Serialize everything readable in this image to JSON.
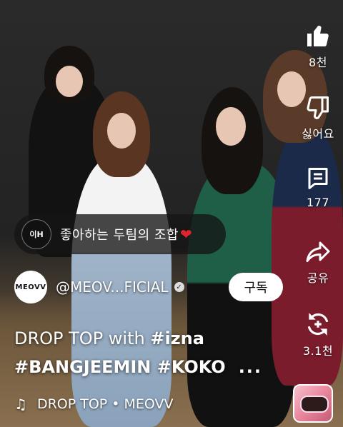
{
  "rail": {
    "like": {
      "icon": "thumbs-up-icon",
      "count": "8천"
    },
    "dislike": {
      "icon": "thumbs-down-icon",
      "label": "싫어요"
    },
    "comments": {
      "icon": "comment-icon",
      "count": "177"
    },
    "share": {
      "icon": "share-icon",
      "label": "공유"
    },
    "remix": {
      "icon": "remix-icon",
      "count": "3.1천"
    }
  },
  "caption": {
    "badge_text": "이H",
    "text": "좋아하는 두팀의 조합",
    "heart": "❤"
  },
  "channel": {
    "avatar_text": "MEOVV",
    "handle": "@MEOV...FICIAL",
    "subscribe_label": "구독"
  },
  "title": {
    "line1_plain": "DROP TOP with ",
    "line1_tag": "#izna",
    "line2": "#BANGJEEMIN #KOKO",
    "more": "..."
  },
  "music": {
    "icon": "music-note-icon",
    "track": "DROP TOP • MEOVV"
  },
  "colors": {
    "heart": "#e0242c",
    "subscribe_bg": "#ffffff"
  }
}
